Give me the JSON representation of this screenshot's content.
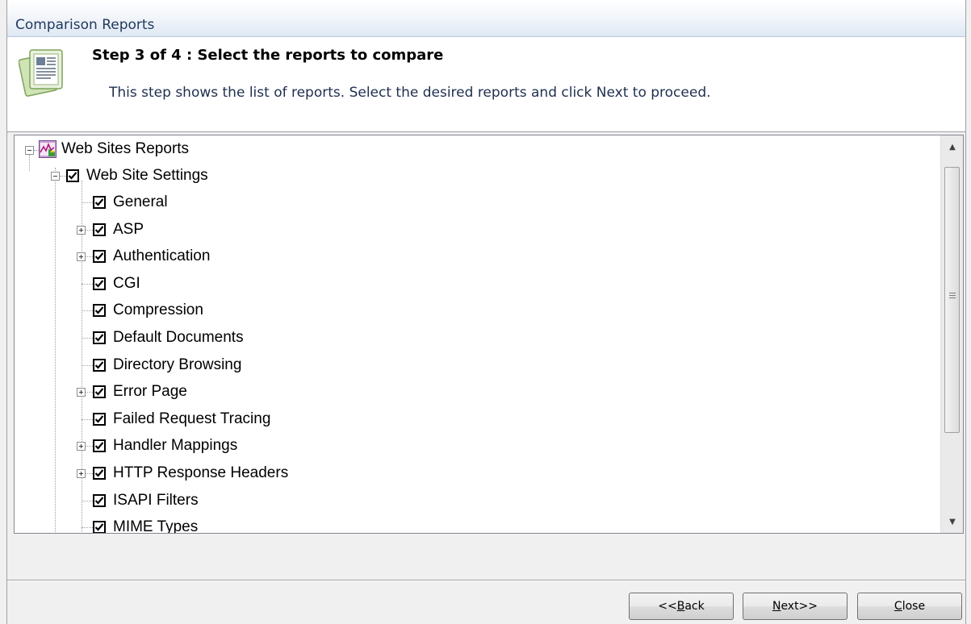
{
  "window": {
    "title": "Comparison Reports"
  },
  "header": {
    "step_title": "Step 3 of 4 : Select the reports to compare",
    "description": "This step shows the list of reports. Select the desired reports and click Next to proceed.",
    "icon": "report-document-icon"
  },
  "tree": {
    "root": {
      "label": "Web Sites Reports",
      "icon": "web-sites-report-icon",
      "expanded": true
    },
    "group": {
      "label": "Web Site Settings",
      "checked": true,
      "expanded": true
    },
    "items": [
      {
        "label": "General",
        "checked": true,
        "expandable": false
      },
      {
        "label": "ASP",
        "checked": true,
        "expandable": true
      },
      {
        "label": "Authentication",
        "checked": true,
        "expandable": true
      },
      {
        "label": "CGI",
        "checked": true,
        "expandable": false
      },
      {
        "label": "Compression",
        "checked": true,
        "expandable": false
      },
      {
        "label": "Default Documents",
        "checked": true,
        "expandable": false
      },
      {
        "label": "Directory Browsing",
        "checked": true,
        "expandable": false
      },
      {
        "label": "Error Page",
        "checked": true,
        "expandable": true
      },
      {
        "label": "Failed Request Tracing",
        "checked": true,
        "expandable": false
      },
      {
        "label": "Handler Mappings",
        "checked": true,
        "expandable": true
      },
      {
        "label": "HTTP Response Headers",
        "checked": true,
        "expandable": true
      },
      {
        "label": "ISAPI Filters",
        "checked": true,
        "expandable": false
      },
      {
        "label": "MIME Types",
        "checked": true,
        "expandable": false
      }
    ]
  },
  "buttons": {
    "back": {
      "prefix": "<<",
      "mnemonic": "B",
      "rest": "ack"
    },
    "next": {
      "mnemonic": "N",
      "rest": "ext>>"
    },
    "close": {
      "mnemonic": "C",
      "rest": "lose"
    }
  }
}
